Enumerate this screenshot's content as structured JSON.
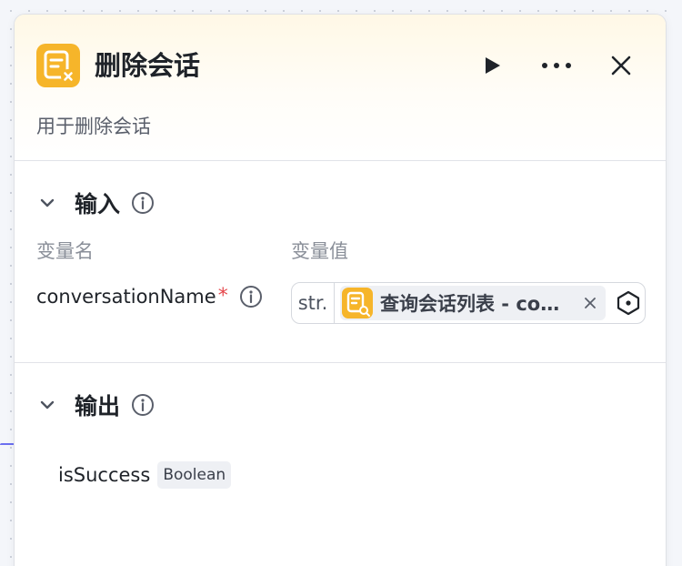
{
  "node": {
    "title": "删除会话",
    "description": "用于删除会话",
    "icon": "document-delete-icon",
    "accent_color": "#f6b52a"
  },
  "header_actions": {
    "run": "play-icon",
    "more": "more-icon",
    "close": "close-icon"
  },
  "input_section": {
    "title": "输入",
    "column_name_label": "变量名",
    "column_value_label": "变量值",
    "params": [
      {
        "name": "conversationName",
        "required_mark": "*",
        "type_tag": "str.",
        "reference": "查询会话列表 - co…"
      }
    ]
  },
  "output_section": {
    "title": "输出",
    "fields": [
      {
        "name": "isSuccess",
        "type": "Boolean"
      }
    ]
  }
}
